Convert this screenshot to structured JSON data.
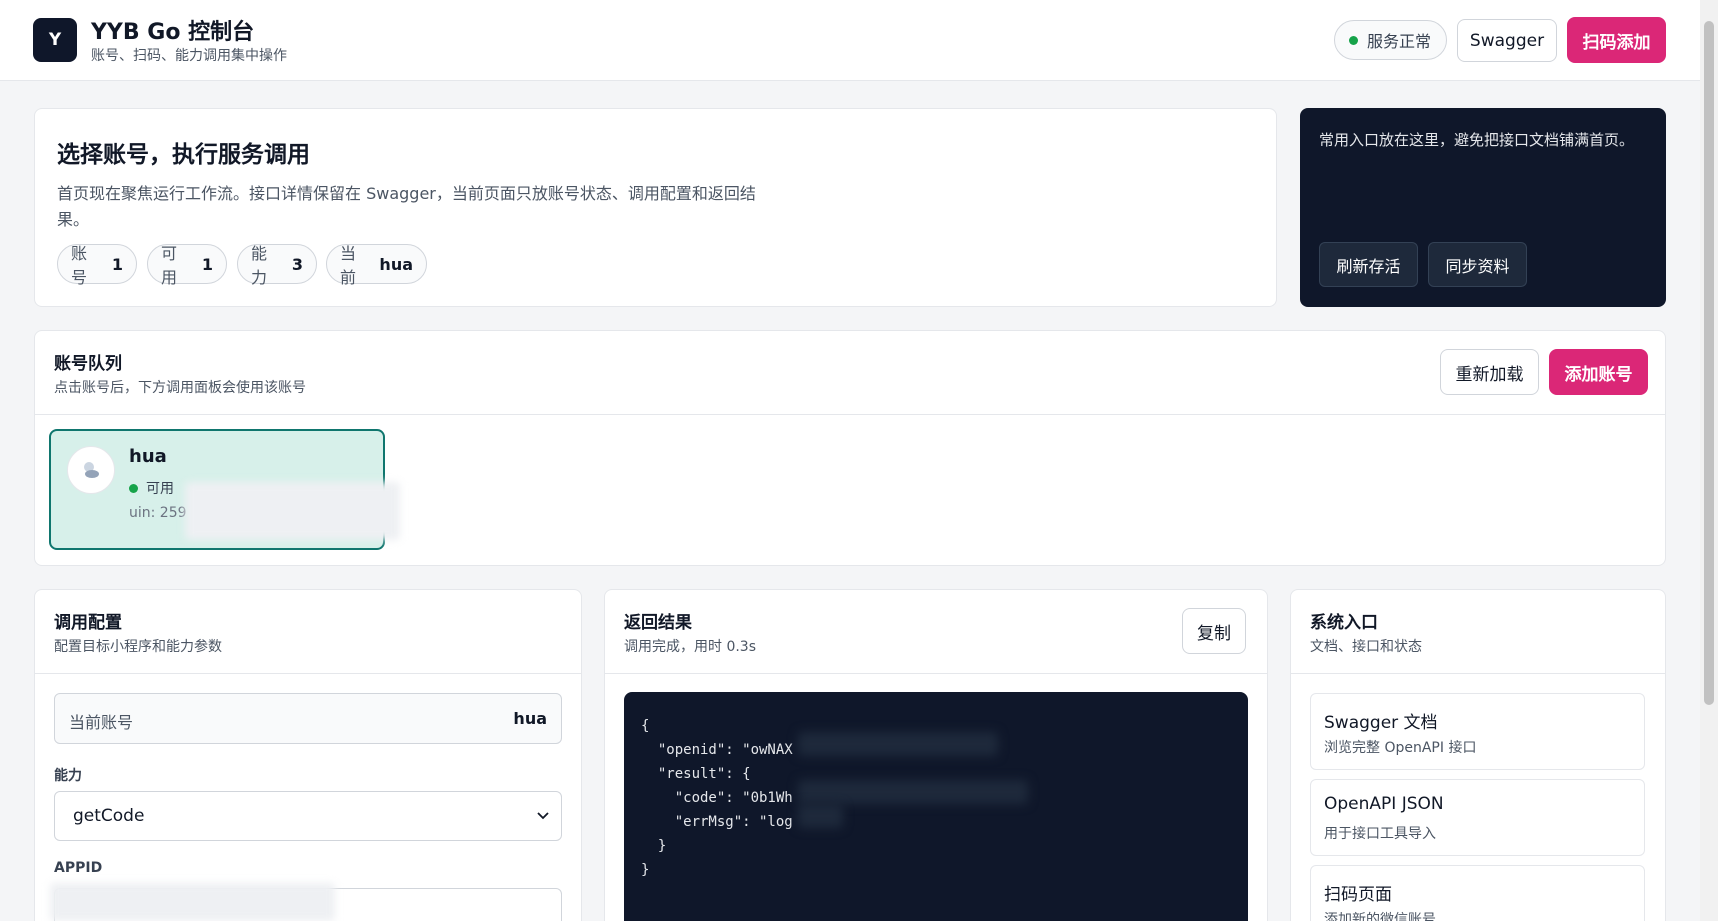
{
  "header": {
    "logo_letter": "Y",
    "title": "YYB Go 控制台",
    "subtitle": "账号、扫码、能力调用集中操作",
    "status_label": "服务正常",
    "swagger_label": "Swagger",
    "scan_add_label": "扫码添加"
  },
  "hero": {
    "title": "选择账号，执行服务调用",
    "description": "首页现在聚焦运行工作流。接口详情保留在 Swagger，当前页面只放账号状态、调用配置和返回结果。",
    "stats": [
      {
        "label": "账号",
        "value": "1"
      },
      {
        "label": "可用",
        "value": "1"
      },
      {
        "label": "能力",
        "value": "3"
      },
      {
        "label": "当前",
        "value": "hua"
      }
    ]
  },
  "shortcuts": {
    "text": "常用入口放在这里，避免把接口文档铺满首页。",
    "refresh_label": "刷新存活",
    "sync_label": "同步资料"
  },
  "queue": {
    "title": "账号队列",
    "subtitle": "点击账号后，下方调用面板会使用该账号",
    "reload_label": "重新加载",
    "add_label": "添加账号",
    "account": {
      "name": "hua",
      "status": "可用",
      "uin_prefix": "uin: 259"
    }
  },
  "config": {
    "title": "调用配置",
    "subtitle": "配置目标小程序和能力参数",
    "current_account_label": "当前账号",
    "current_account_value": "hua",
    "ability_label": "能力",
    "ability_value": "getCode",
    "appid_label": "APPID"
  },
  "result": {
    "title": "返回结果",
    "subtitle": "调用完成，用时 0.3s",
    "copy_label": "复制",
    "code": "{\n  \"openid\": \"owNAX\n  \"result\": {\n    \"code\": \"0b1Wh\n    \"errMsg\": \"log\n  }\n}"
  },
  "system": {
    "title": "系统入口",
    "subtitle": "文档、接口和状态",
    "links": [
      {
        "title": "Swagger 文档",
        "sub": "浏览完整 OpenAPI 接口"
      },
      {
        "title": "OpenAPI JSON",
        "sub": "用于接口工具导入"
      },
      {
        "title": "扫码页面",
        "sub": "添加新的微信账号"
      }
    ]
  },
  "colors": {
    "primary": "#db2777",
    "dark": "#0f172a",
    "success": "#16a34a",
    "selected_bg": "#d7f0ea",
    "selected_border": "#0f766e"
  }
}
